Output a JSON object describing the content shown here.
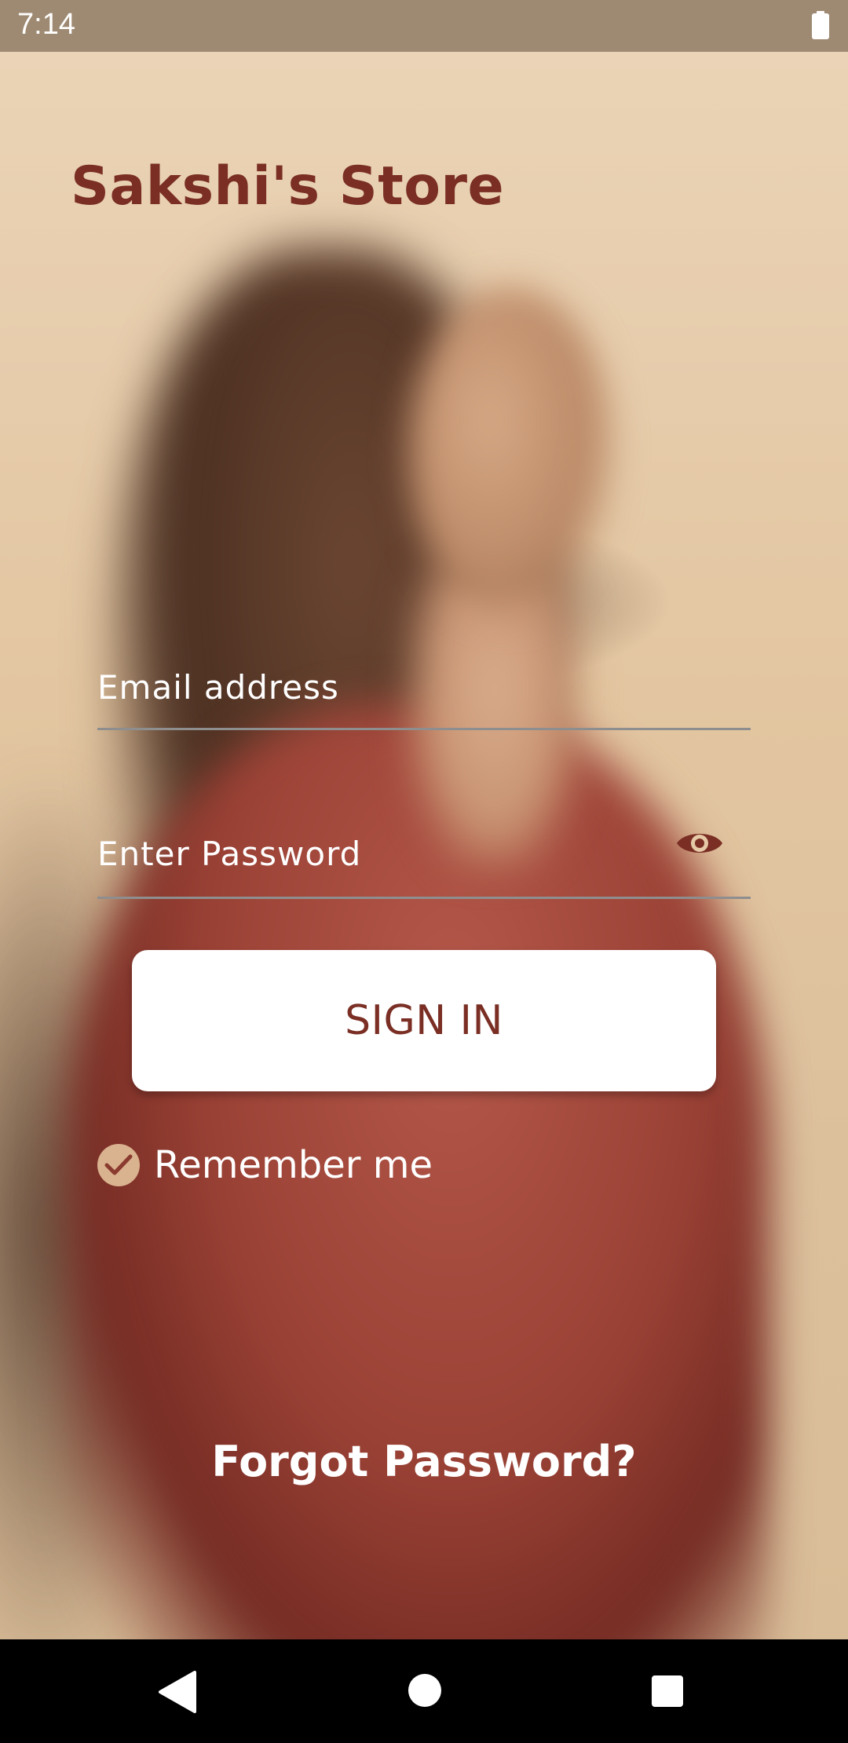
{
  "status_bar": {
    "time": "7:14",
    "battery_icon": "battery-full-icon"
  },
  "app": {
    "title": "Sakshi's Store"
  },
  "form": {
    "email_placeholder": "Email address",
    "email_value": "",
    "password_placeholder": "Enter Password",
    "password_value": "",
    "password_toggle_icon": "eye-icon",
    "signin_label": "SIGN IN",
    "remember_label": "Remember me",
    "remember_checked": true,
    "forgot_label": "Forgot Password?"
  },
  "colors": {
    "brand": "#7a2e24",
    "accent": "#d9b28f",
    "status_bar": "#9e8a72"
  },
  "nav": {
    "back_icon": "back-triangle-icon",
    "home_icon": "home-circle-icon",
    "recents_icon": "recents-square-icon"
  }
}
